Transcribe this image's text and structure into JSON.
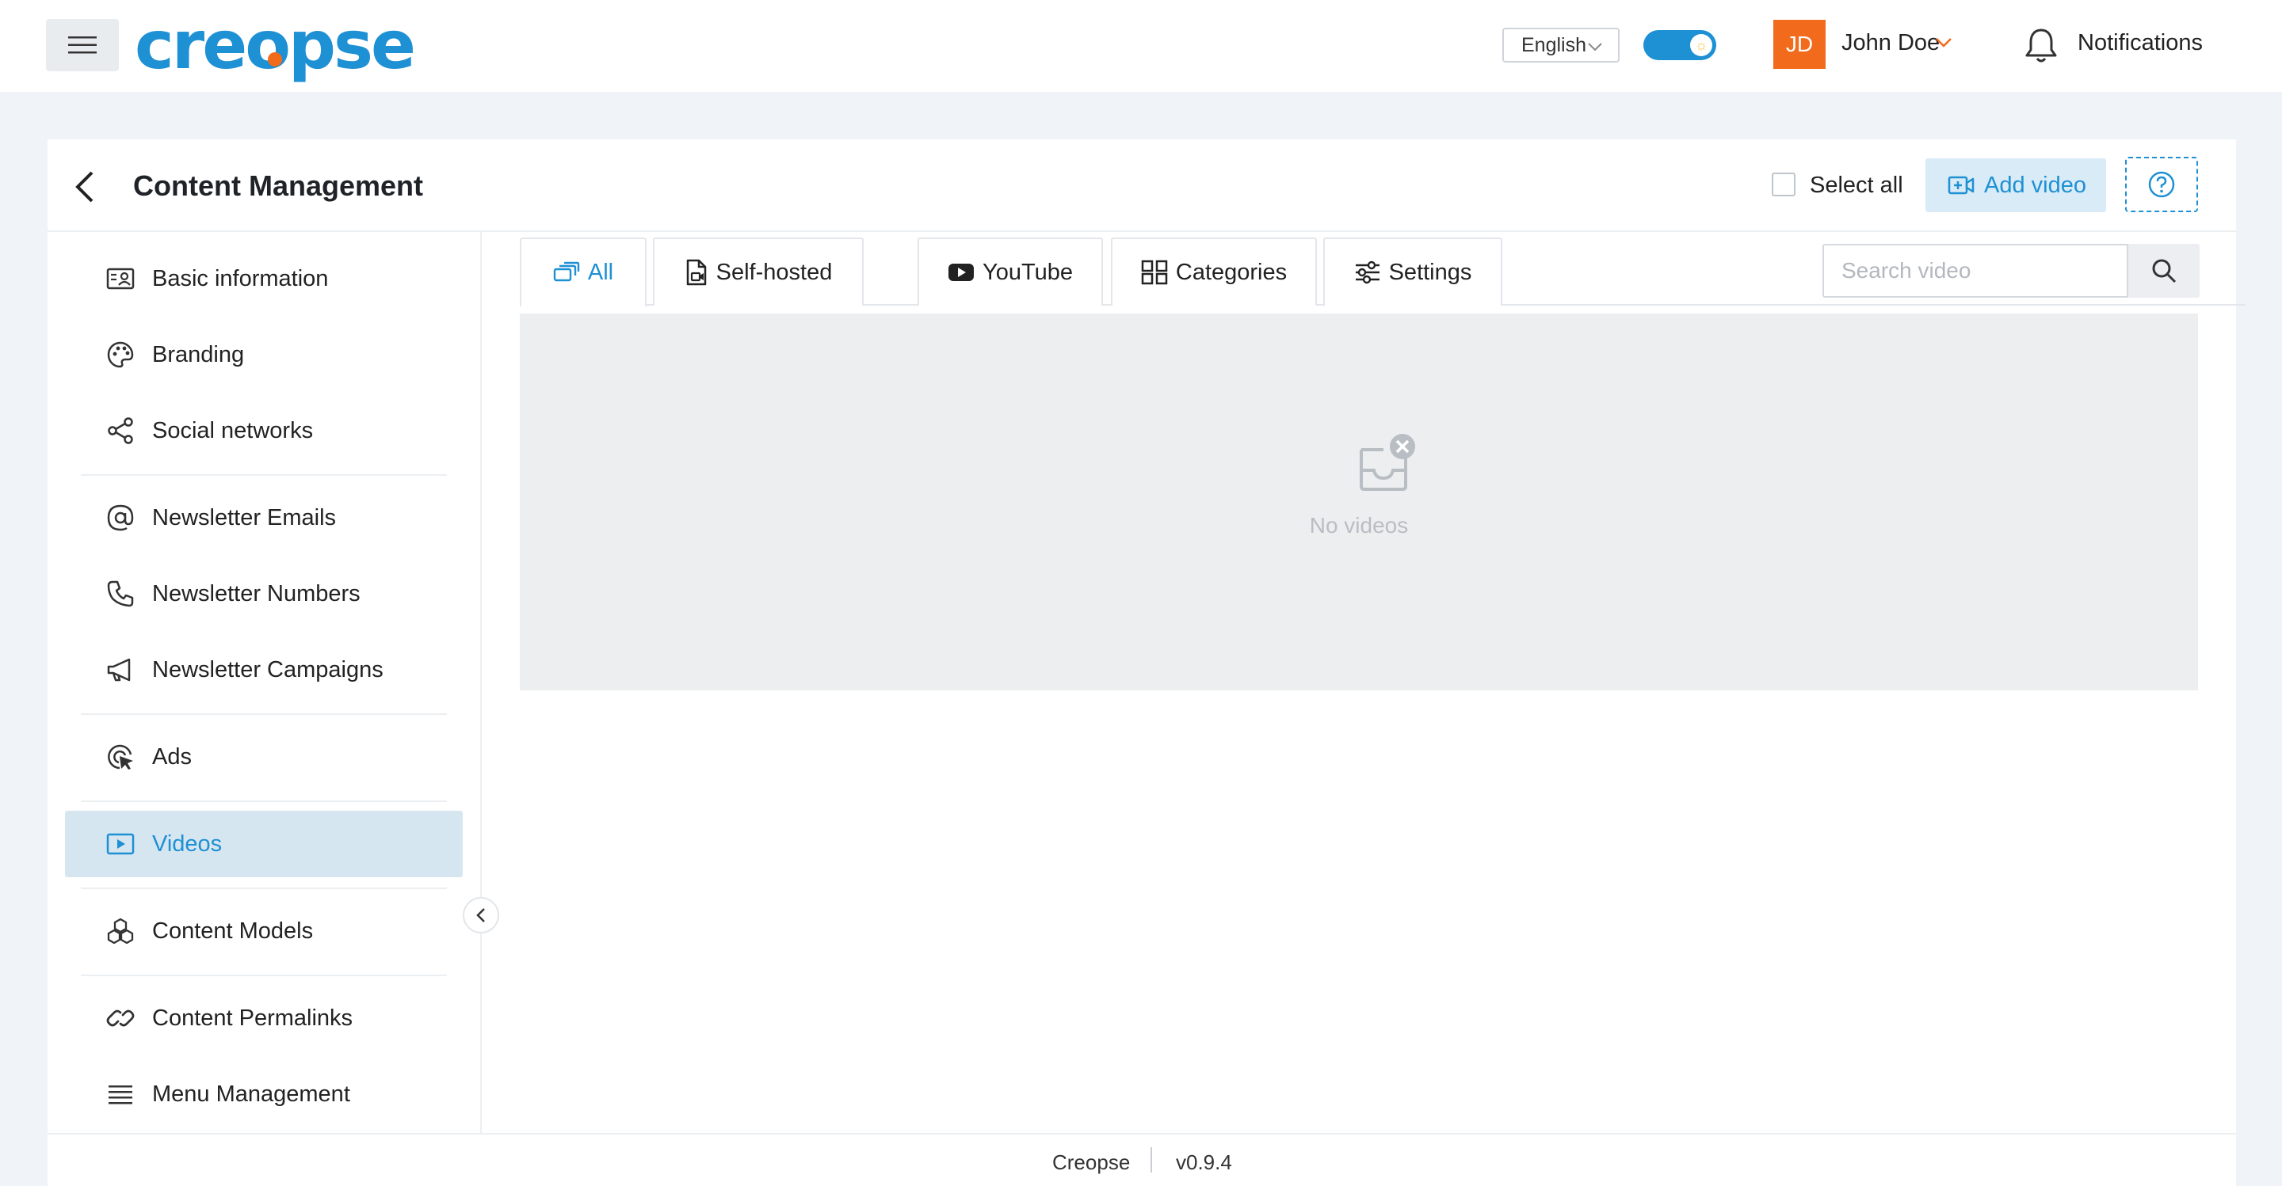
{
  "header": {
    "brand": "creopse",
    "language": "English",
    "avatar_initials": "JD",
    "user_name": "John Doe",
    "notifications_label": "Notifications"
  },
  "page": {
    "title": "Content Management",
    "select_all_label": "Select all",
    "add_video_label": "Add video"
  },
  "sidebar": {
    "items": [
      {
        "label": "Basic information",
        "icon": "id-card-icon"
      },
      {
        "label": "Branding",
        "icon": "palette-icon"
      },
      {
        "label": "Social networks",
        "icon": "share-icon"
      },
      {
        "label": "Newsletter Emails",
        "icon": "at-icon"
      },
      {
        "label": "Newsletter Numbers",
        "icon": "phone-icon"
      },
      {
        "label": "Newsletter Campaigns",
        "icon": "megaphone-icon"
      },
      {
        "label": "Ads",
        "icon": "target-cursor-icon"
      },
      {
        "label": "Videos",
        "icon": "video-icon",
        "active": true
      },
      {
        "label": "Content Models",
        "icon": "cubes-icon"
      },
      {
        "label": "Content Permalinks",
        "icon": "link-icon"
      },
      {
        "label": "Menu Management",
        "icon": "menu-lines-icon"
      }
    ]
  },
  "tabs": [
    {
      "label": "All",
      "icon": "cards-icon",
      "active": true
    },
    {
      "label": "Self-hosted",
      "icon": "file-video-icon"
    },
    {
      "label": "YouTube",
      "icon": "youtube-icon"
    },
    {
      "label": "Categories",
      "icon": "grid-icon"
    },
    {
      "label": "Settings",
      "icon": "sliders-icon"
    }
  ],
  "search": {
    "placeholder": "Search video",
    "value": ""
  },
  "empty_state": {
    "text": "No videos",
    "icon": "empty-inbox-icon"
  },
  "footer": {
    "brand": "Creopse",
    "version": "v0.9.4"
  },
  "colors": {
    "accent": "#1e90d4",
    "brand_orange": "#f26a1b",
    "active_nav_bg": "#d6e6f1"
  }
}
